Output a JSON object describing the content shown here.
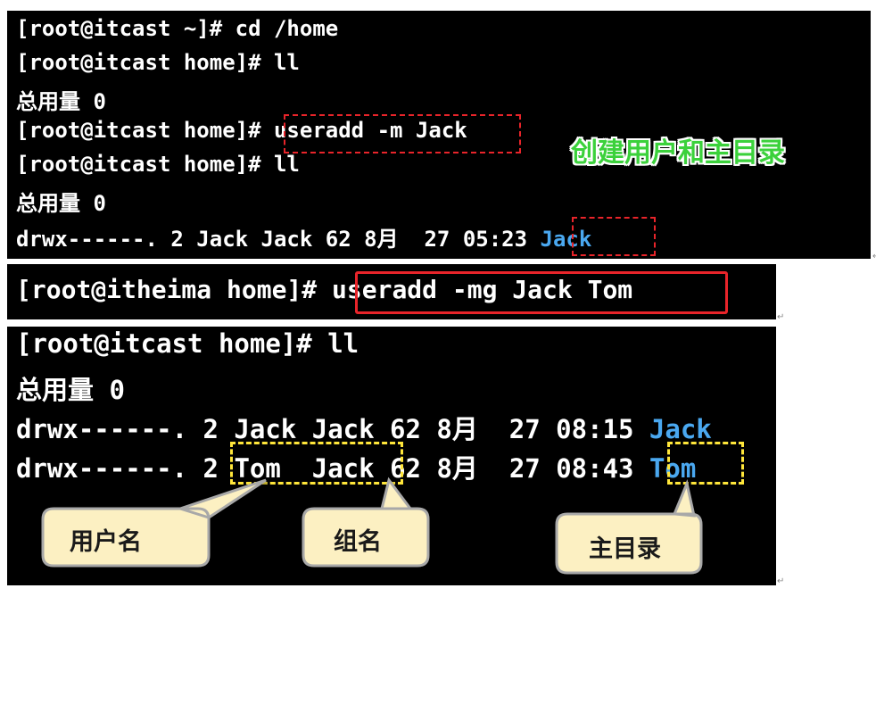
{
  "terminal_1": {
    "lines": [
      "[root@itcast ~]# cd /home",
      "[root@itcast home]# ll",
      "总用量 0",
      "[root@itcast home]# ",
      "[root@itcast home]# ll",
      "总用量 0",
      "drwx------. 2 Jack Jack 62 8月  27 05:23 "
    ],
    "command_useradd": "useradd -m Jack",
    "listing_dir": "Jack",
    "caption": "创建用户和主目录"
  },
  "terminal_2": {
    "prompt": "[root@itheima home]# ",
    "command": "useradd -mg Jack Tom"
  },
  "terminal_3": {
    "prompt_line": "[root@itcast home]# ll",
    "total_line": "总用量 0",
    "row1_prefix": "drwx------. 2 Jack Jack 62 8月  27 08:15 ",
    "row1_dir": "Jack",
    "row2_prefix": "drwx------. 2",
    "row2_owner_group": "Tom  Jack",
    "row2_mid": "62 8月  27 08:43",
    "row2_dir": "Tom"
  },
  "callouts": {
    "username": "用户名",
    "groupname": "组名",
    "homedir": "主目录"
  },
  "paragraph_mark": "↵",
  "colors": {
    "terminal_bg": "#000000",
    "terminal_text": "#ffffff",
    "directory_blue": "#4aa8f0",
    "highlight_red": "#e8242a",
    "highlight_yellow": "#ffe63a",
    "caption_green": "#3bd13b",
    "callout_fill": "#fcf0c2"
  }
}
